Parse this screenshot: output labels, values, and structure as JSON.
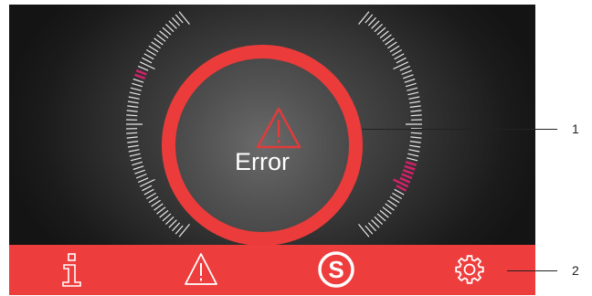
{
  "status": {
    "label": "Error",
    "ring_color": "#ec3b3b",
    "icon": "warning-triangle-icon"
  },
  "gauges": [
    {
      "side": "left",
      "marker_color": "#d3216a",
      "markers": 1
    },
    {
      "side": "right",
      "marker_color": "#d3216a",
      "markers": 2
    }
  ],
  "nav_bar": {
    "color": "#ee3d3d",
    "buttons": [
      {
        "name": "info",
        "icon": "info-icon"
      },
      {
        "name": "warnings",
        "icon": "warning-icon"
      },
      {
        "name": "service",
        "icon": "service-s-icon"
      },
      {
        "name": "settings",
        "icon": "gear-icon"
      }
    ]
  },
  "callouts": [
    {
      "number": "1"
    },
    {
      "number": "2"
    }
  ]
}
